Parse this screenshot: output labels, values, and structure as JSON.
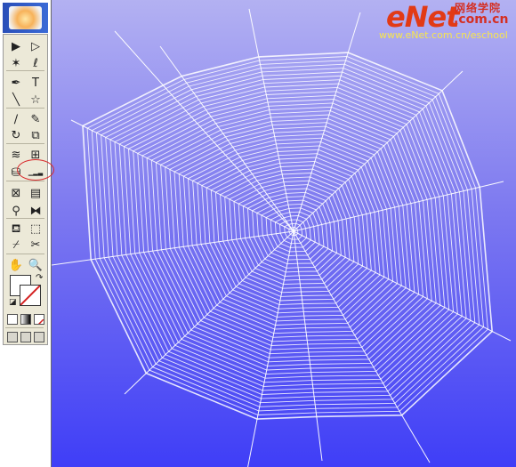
{
  "toolbox": {
    "tools": [
      {
        "name": "selection-tool",
        "glyph": "▶"
      },
      {
        "name": "direct-selection-tool",
        "glyph": "▷"
      },
      {
        "name": "magic-wand-tool",
        "glyph": "✶"
      },
      {
        "name": "lasso-tool",
        "glyph": "ℓ"
      },
      {
        "name": "pen-tool",
        "glyph": "✒"
      },
      {
        "name": "type-tool",
        "glyph": "T"
      },
      {
        "name": "line-tool",
        "glyph": "╲"
      },
      {
        "name": "star-tool",
        "glyph": "☆"
      },
      {
        "name": "paintbrush-tool",
        "glyph": "∕"
      },
      {
        "name": "pencil-tool",
        "glyph": "✎"
      },
      {
        "name": "rotate-tool",
        "glyph": "↻"
      },
      {
        "name": "scale-tool",
        "glyph": "⧉"
      },
      {
        "name": "warp-tool",
        "glyph": "≋"
      },
      {
        "name": "free-transform-tool",
        "glyph": "⊞"
      },
      {
        "name": "symbol-sprayer-tool",
        "glyph": "⛁"
      },
      {
        "name": "graph-tool",
        "glyph": "▁▂▃"
      },
      {
        "name": "mesh-tool",
        "glyph": "⊠"
      },
      {
        "name": "gradient-tool",
        "glyph": "▤"
      },
      {
        "name": "eyedropper-tool",
        "glyph": "⚲"
      },
      {
        "name": "blend-tool",
        "glyph": "⧓"
      },
      {
        "name": "live-paint-bucket-tool",
        "glyph": "⛾"
      },
      {
        "name": "live-paint-selection-tool",
        "glyph": "⬚"
      },
      {
        "name": "slice-tool",
        "glyph": "⌿"
      },
      {
        "name": "scissors-tool",
        "glyph": "✂"
      },
      {
        "name": "hand-tool",
        "glyph": "✋"
      },
      {
        "name": "zoom-tool",
        "glyph": "🔍"
      }
    ]
  },
  "brand": {
    "logo_text": "eNet",
    "logo_cn": "网络学院",
    "logo_com": ".com.cn",
    "url": "www.eNet.com.cn/eschool"
  },
  "colors": {
    "canvas_top": "#b3b1f2",
    "canvas_bottom": "#3f3ef7",
    "web_thread": "#ffffff",
    "highlight_circle": "#d8282a",
    "brand_red": "#e23a16",
    "brand_url": "#f7e54d"
  }
}
